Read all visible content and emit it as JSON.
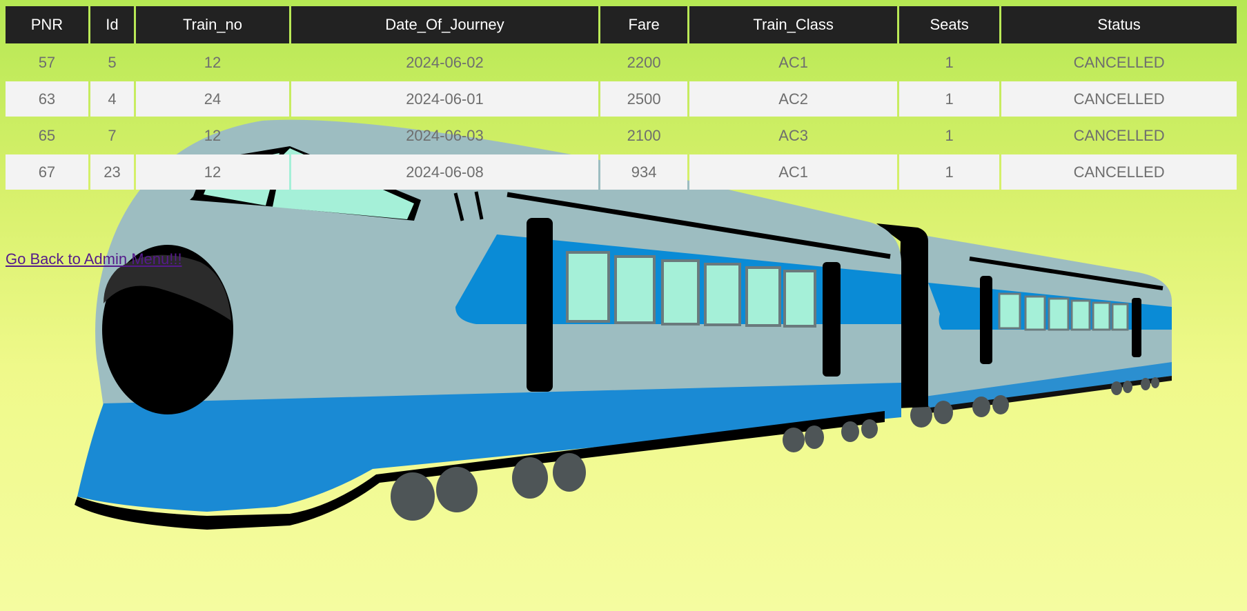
{
  "table": {
    "headers": [
      "PNR",
      "Id",
      "Train_no",
      "Date_Of_Journey",
      "Fare",
      "Train_Class",
      "Seats",
      "Status"
    ],
    "rows": [
      [
        "57",
        "5",
        "12",
        "2024-06-02",
        "2200",
        "AC1",
        "1",
        "CANCELLED"
      ],
      [
        "63",
        "4",
        "24",
        "2024-06-01",
        "2500",
        "AC2",
        "1",
        "CANCELLED"
      ],
      [
        "65",
        "7",
        "12",
        "2024-06-03",
        "2100",
        "AC3",
        "1",
        "CANCELLED"
      ],
      [
        "67",
        "23",
        "12",
        "2024-06-08",
        "934",
        "AC1",
        "1",
        "CANCELLED"
      ]
    ]
  },
  "back_link": "Go Back to Admin Menu!!!",
  "colors": {
    "header_bg": "#222222",
    "accent_blue": "#1a8ad4",
    "train_body": "#9dbdc1",
    "link": "#551a8b"
  },
  "background_image": "bullet-train-illustration"
}
